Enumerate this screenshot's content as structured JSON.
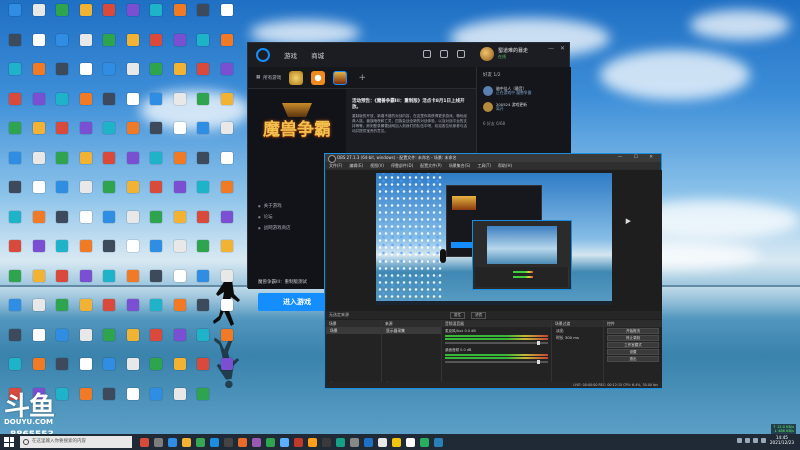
{
  "watermark": {
    "logo": "斗鱼",
    "site": "DOUYU.COM",
    "room_id": "8865553"
  },
  "battlenet": {
    "nav": [
      "游戏",
      "商城"
    ],
    "user": {
      "name": "蜀道难的暴走",
      "status": "在线"
    },
    "all_games_tab": "所有游戏",
    "game_logo_text": "魔兽争霸",
    "links": [
      "关于游戏",
      "论坛",
      "战网游戏商店"
    ],
    "version_label": "魔兽争霸III：重制版测试",
    "play_button": "进入游戏",
    "news_title": "活动预告：《魔兽争霸III：重制版》活点卡8月1日上线开放。",
    "news_body": "重制版的开放，新增不错的对战内容，在这里你将获得更多游戏，畅玩经典人族、兽族暗夜和亡灵，四族会战全新的对战体验，以及对战平台的支持等等。即刻登录暴雪战网加入到我们的队伍中吧，欢迎各位玩家参与活动并提供宝贵的意见。",
    "friends_header": "好友 1/2",
    "friends": [
      {
        "name": "暗中佳人（静音）",
        "status": "正在游戏中 魔兽争霸"
      },
      {
        "name": "200524 游戏更新",
        "status": "离开"
      }
    ],
    "friends_section": "6 好友 6/68"
  },
  "obs": {
    "title": "OBS 27.1.3 (64-bit, windows) - 配置文件: 未命名 - 场景: 未命名",
    "menu": [
      "文件(F)",
      "编辑(E)",
      "视图(V)",
      "停靠部件(D)",
      "配置文件(P)",
      "场景集合(S)",
      "工具(T)",
      "帮助(H)"
    ],
    "window_controls": "— ☐ ✕",
    "scene_bar_label": "无选定来源",
    "scene_bar_buttons": [
      "属性",
      "滤镜"
    ],
    "docks": {
      "scenes_header": "场景",
      "scenes": [
        "场景"
      ],
      "sources_header": "来源",
      "sources": [
        "显示器采集"
      ],
      "mixer_header": "音频混音器",
      "mixer": [
        {
          "label": "麦克风/Aux",
          "db": "0.0 dB"
        },
        {
          "label": "桌面音频",
          "db": "0.0 dB"
        }
      ],
      "transitions_header": "场景过渡",
      "transition_type": "淡出",
      "duration_label": "时长",
      "duration_value": "300 ms",
      "controls_header": "控件",
      "controls": [
        "开始推流",
        "停止录制",
        "工作室模式",
        "设置",
        "退出"
      ],
      "footer_buttons": "+ − ∧ ∨"
    },
    "status_bar": "LIVE: 00:00:00   REC: 00:12:15   CPU: 6.4%, 30.00 fps"
  },
  "taskbar": {
    "search_placeholder": "在这里输入你要搜索的内容",
    "time": "14:45",
    "date": "2021/12/23",
    "net_speed_up": "↑ 12.0 KB/s",
    "net_speed_down": "↓ 486 KB/s"
  },
  "colors": {
    "accent": "#148eff",
    "obs_border": "#1b8ee0"
  }
}
